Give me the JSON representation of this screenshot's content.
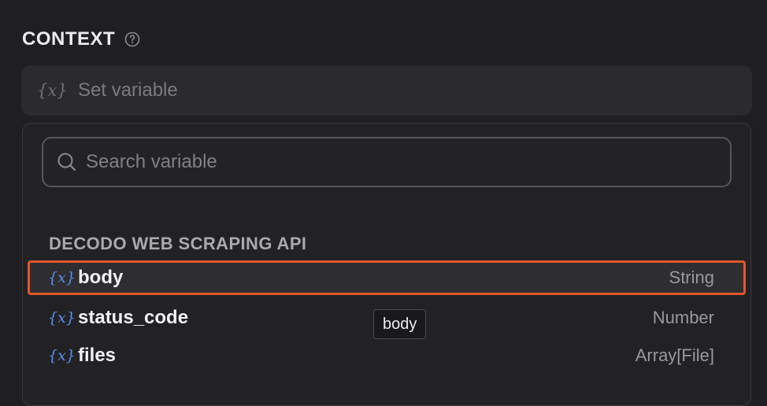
{
  "section": {
    "title": "CONTEXT",
    "help_icon": "question-circle-icon"
  },
  "set_variable": {
    "icon": "{x}",
    "label": "Set variable"
  },
  "search": {
    "placeholder": "Search variable",
    "value": ""
  },
  "group": {
    "label": "DECODO WEB SCRAPING API"
  },
  "variables": [
    {
      "icon": "{x}",
      "name": "body",
      "type": "String",
      "selected": true
    },
    {
      "icon": "{x}",
      "name": "status_code",
      "type": "Number",
      "selected": false
    },
    {
      "icon": "{x}",
      "name": "files",
      "type": "Array[File]",
      "selected": false
    }
  ],
  "tooltip": {
    "text": "body"
  },
  "colors": {
    "background": "#1f1f21",
    "accent_highlight": "#e2572b",
    "variable_icon": "#5b8def"
  }
}
